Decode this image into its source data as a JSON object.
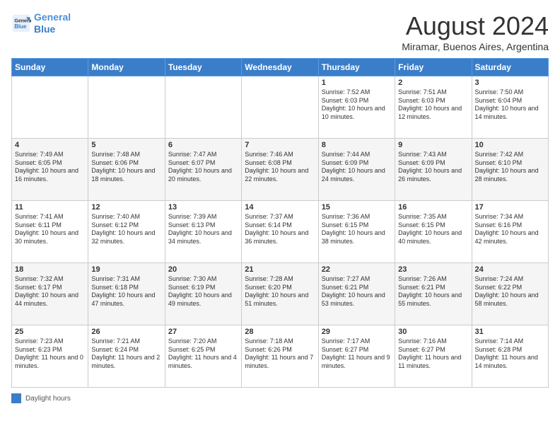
{
  "header": {
    "logo_line1": "General",
    "logo_line2": "Blue",
    "title": "August 2024",
    "location": "Miramar, Buenos Aires, Argentina"
  },
  "weekdays": [
    "Sunday",
    "Monday",
    "Tuesday",
    "Wednesday",
    "Thursday",
    "Friday",
    "Saturday"
  ],
  "weeks": [
    [
      {
        "day": "",
        "info": ""
      },
      {
        "day": "",
        "info": ""
      },
      {
        "day": "",
        "info": ""
      },
      {
        "day": "",
        "info": ""
      },
      {
        "day": "1",
        "info": "Sunrise: 7:52 AM\nSunset: 6:03 PM\nDaylight: 10 hours and 10 minutes."
      },
      {
        "day": "2",
        "info": "Sunrise: 7:51 AM\nSunset: 6:03 PM\nDaylight: 10 hours and 12 minutes."
      },
      {
        "day": "3",
        "info": "Sunrise: 7:50 AM\nSunset: 6:04 PM\nDaylight: 10 hours and 14 minutes."
      }
    ],
    [
      {
        "day": "4",
        "info": "Sunrise: 7:49 AM\nSunset: 6:05 PM\nDaylight: 10 hours and 16 minutes."
      },
      {
        "day": "5",
        "info": "Sunrise: 7:48 AM\nSunset: 6:06 PM\nDaylight: 10 hours and 18 minutes."
      },
      {
        "day": "6",
        "info": "Sunrise: 7:47 AM\nSunset: 6:07 PM\nDaylight: 10 hours and 20 minutes."
      },
      {
        "day": "7",
        "info": "Sunrise: 7:46 AM\nSunset: 6:08 PM\nDaylight: 10 hours and 22 minutes."
      },
      {
        "day": "8",
        "info": "Sunrise: 7:44 AM\nSunset: 6:09 PM\nDaylight: 10 hours and 24 minutes."
      },
      {
        "day": "9",
        "info": "Sunrise: 7:43 AM\nSunset: 6:09 PM\nDaylight: 10 hours and 26 minutes."
      },
      {
        "day": "10",
        "info": "Sunrise: 7:42 AM\nSunset: 6:10 PM\nDaylight: 10 hours and 28 minutes."
      }
    ],
    [
      {
        "day": "11",
        "info": "Sunrise: 7:41 AM\nSunset: 6:11 PM\nDaylight: 10 hours and 30 minutes."
      },
      {
        "day": "12",
        "info": "Sunrise: 7:40 AM\nSunset: 6:12 PM\nDaylight: 10 hours and 32 minutes."
      },
      {
        "day": "13",
        "info": "Sunrise: 7:39 AM\nSunset: 6:13 PM\nDaylight: 10 hours and 34 minutes."
      },
      {
        "day": "14",
        "info": "Sunrise: 7:37 AM\nSunset: 6:14 PM\nDaylight: 10 hours and 36 minutes."
      },
      {
        "day": "15",
        "info": "Sunrise: 7:36 AM\nSunset: 6:15 PM\nDaylight: 10 hours and 38 minutes."
      },
      {
        "day": "16",
        "info": "Sunrise: 7:35 AM\nSunset: 6:15 PM\nDaylight: 10 hours and 40 minutes."
      },
      {
        "day": "17",
        "info": "Sunrise: 7:34 AM\nSunset: 6:16 PM\nDaylight: 10 hours and 42 minutes."
      }
    ],
    [
      {
        "day": "18",
        "info": "Sunrise: 7:32 AM\nSunset: 6:17 PM\nDaylight: 10 hours and 44 minutes."
      },
      {
        "day": "19",
        "info": "Sunrise: 7:31 AM\nSunset: 6:18 PM\nDaylight: 10 hours and 47 minutes."
      },
      {
        "day": "20",
        "info": "Sunrise: 7:30 AM\nSunset: 6:19 PM\nDaylight: 10 hours and 49 minutes."
      },
      {
        "day": "21",
        "info": "Sunrise: 7:28 AM\nSunset: 6:20 PM\nDaylight: 10 hours and 51 minutes."
      },
      {
        "day": "22",
        "info": "Sunrise: 7:27 AM\nSunset: 6:21 PM\nDaylight: 10 hours and 53 minutes."
      },
      {
        "day": "23",
        "info": "Sunrise: 7:26 AM\nSunset: 6:21 PM\nDaylight: 10 hours and 55 minutes."
      },
      {
        "day": "24",
        "info": "Sunrise: 7:24 AM\nSunset: 6:22 PM\nDaylight: 10 hours and 58 minutes."
      }
    ],
    [
      {
        "day": "25",
        "info": "Sunrise: 7:23 AM\nSunset: 6:23 PM\nDaylight: 11 hours and 0 minutes."
      },
      {
        "day": "26",
        "info": "Sunrise: 7:21 AM\nSunset: 6:24 PM\nDaylight: 11 hours and 2 minutes."
      },
      {
        "day": "27",
        "info": "Sunrise: 7:20 AM\nSunset: 6:25 PM\nDaylight: 11 hours and 4 minutes."
      },
      {
        "day": "28",
        "info": "Sunrise: 7:18 AM\nSunset: 6:26 PM\nDaylight: 11 hours and 7 minutes."
      },
      {
        "day": "29",
        "info": "Sunrise: 7:17 AM\nSunset: 6:27 PM\nDaylight: 11 hours and 9 minutes."
      },
      {
        "day": "30",
        "info": "Sunrise: 7:16 AM\nSunset: 6:27 PM\nDaylight: 11 hours and 11 minutes."
      },
      {
        "day": "31",
        "info": "Sunrise: 7:14 AM\nSunset: 6:28 PM\nDaylight: 11 hours and 14 minutes."
      }
    ]
  ],
  "legend": "Daylight hours"
}
